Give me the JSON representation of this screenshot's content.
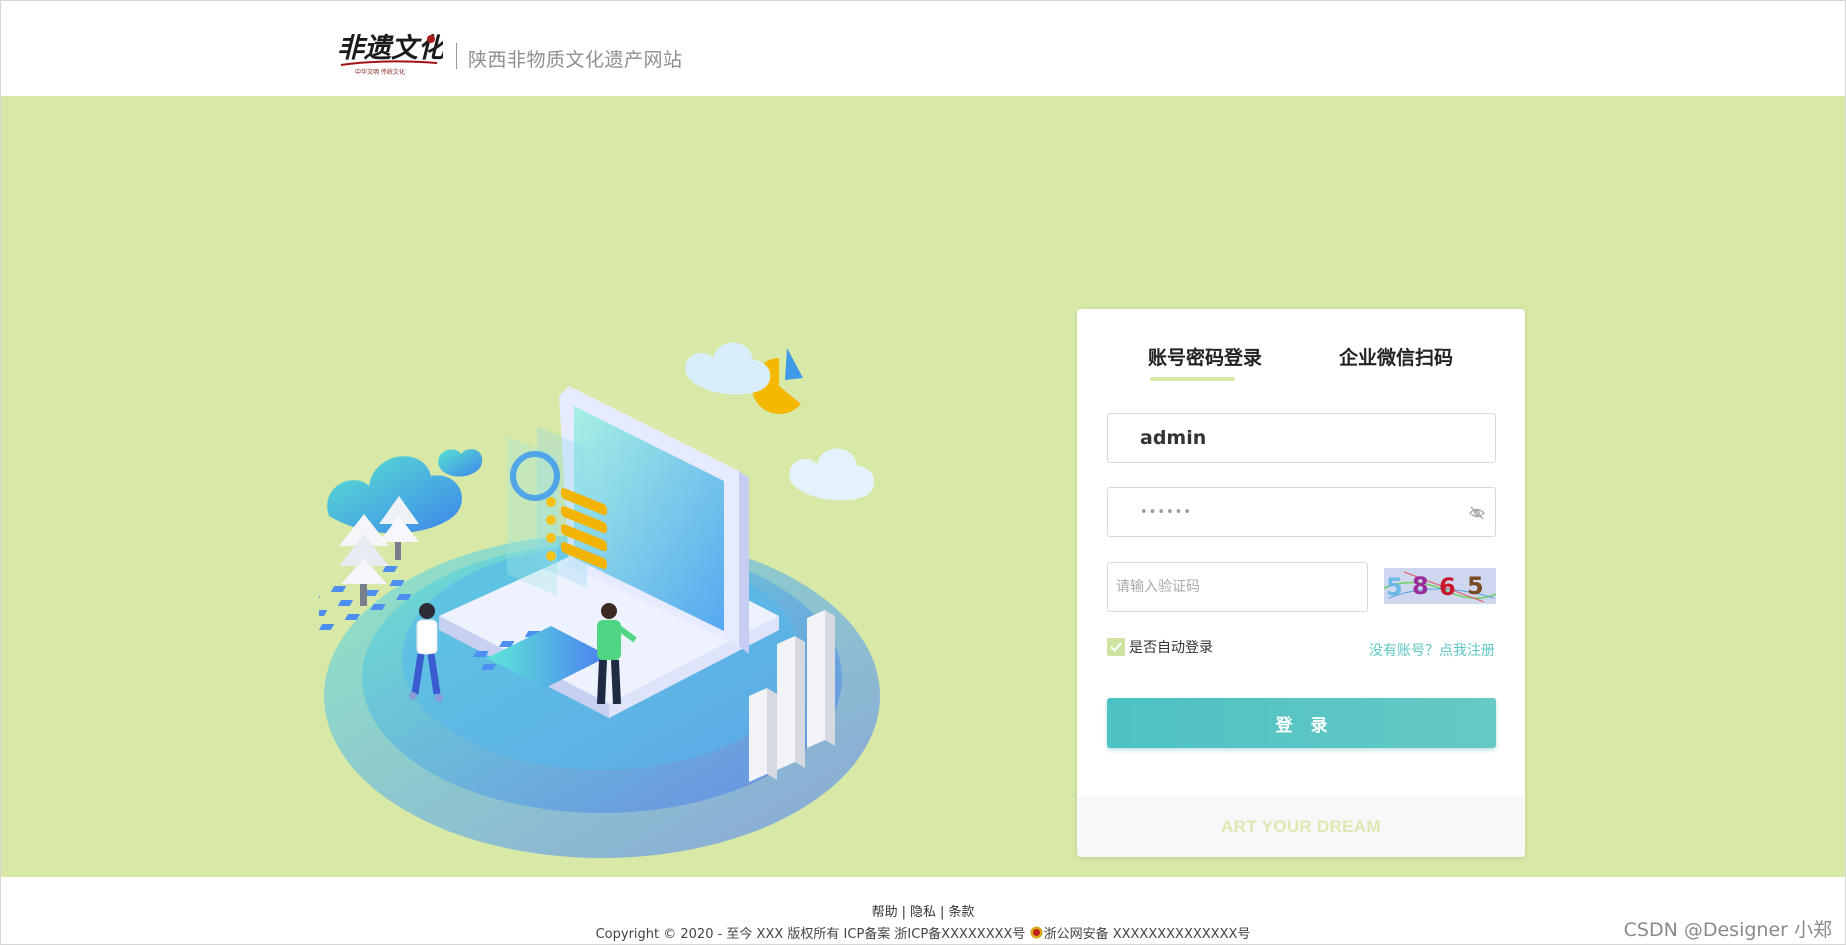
{
  "header": {
    "logo_text": "非遗文化",
    "logo_subtext": "中华文明 传统文化",
    "site_title": "陕西非物质文化遗产网站"
  },
  "login": {
    "tabs": [
      {
        "label": "账号密码登录",
        "active": true
      },
      {
        "label": "企业微信扫码",
        "active": false
      }
    ],
    "username_value": "admin",
    "password_value": "••••••",
    "captcha_placeholder": "请输入验证码",
    "captcha_code": [
      "5",
      "8",
      "6",
      "5"
    ],
    "remember_label": "是否自动登录",
    "remember_checked": true,
    "register_link": "没有账号？点我注册",
    "login_button": "登录",
    "slogan": "ART YOUR DREAM"
  },
  "footer": {
    "links": [
      "帮助",
      "隐私",
      "条款"
    ],
    "separator": "|",
    "copyright": "Copyright © 2020 - 至今 XXX 版权所有 ICP备案 浙ICP备XXXXXXXX号",
    "police_record": "浙公网安备 XXXXXXXXXXXXXX号"
  },
  "watermark": "CSDN @Designer 小郑",
  "colors": {
    "hero_bg": "#d8e8a6",
    "accent_teal": "#5cc7c1",
    "button_gradient_start": "#4dc1c3",
    "tab_underline": "#d8e8a6"
  },
  "icons": {
    "eye": "eye-slash-icon",
    "checkbox": "checkmark-icon",
    "police": "police-badge-icon"
  }
}
